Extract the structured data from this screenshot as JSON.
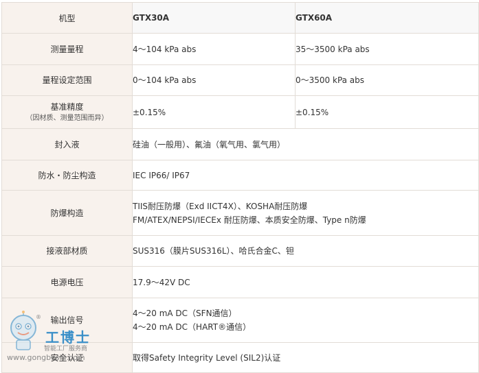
{
  "table": {
    "header": {
      "label": "机型",
      "col1": "GTX30A",
      "col2": "GTX60A"
    },
    "rows": {
      "range": {
        "label": "测量量程",
        "v1": "4～104 kPa abs",
        "v2": "35～3500 kPa abs"
      },
      "setting": {
        "label": "量程设定范围",
        "v1": "0～104 kPa abs",
        "v2": "0～3500 kPa abs"
      },
      "accuracy": {
        "label": "基准精度",
        "sublabel": "（因材质、测量范围而异）",
        "v1": "±0.15%",
        "v2": "±0.15%"
      },
      "fill": {
        "label": "封入液",
        "value": "硅油（一般用）、氟油（氧气用、氯气用）"
      },
      "waterproof": {
        "label": "防水・防尘构造",
        "value": "IEC IP66/ IP67"
      },
      "explosion": {
        "label": "防爆构造",
        "line1": "TIIS耐压防爆（Exd IICT4X）、KOSHA耐压防爆",
        "line2": "FM/ATEX/NEPSI/IECEx 耐压防爆、本质安全防爆、Type n防爆"
      },
      "material": {
        "label": "接液部材质",
        "value": "SUS316（膜片SUS316L）、哈氏合金C、钽"
      },
      "power": {
        "label": "电源电压",
        "value": "17.9～42V DC"
      },
      "output": {
        "label": "输出信号",
        "line1": "4～20 mA DC（SFN通信）",
        "line2": "4～20 mA DC（HART®通信）"
      },
      "safety": {
        "label": "安全认证",
        "value": "取得Safety Integrity Level (SIL2)认证"
      }
    }
  },
  "watermark": {
    "brand": "工博士",
    "tagline": "智能工厂服务商",
    "url": "www.gongboshi.com",
    "reg": "®"
  },
  "colors": {
    "label_bg": "#f8f2ed",
    "header_bg": "#f8f8f8",
    "border": "#e2dcd6",
    "watermark_blue": "#3a8fc8"
  }
}
